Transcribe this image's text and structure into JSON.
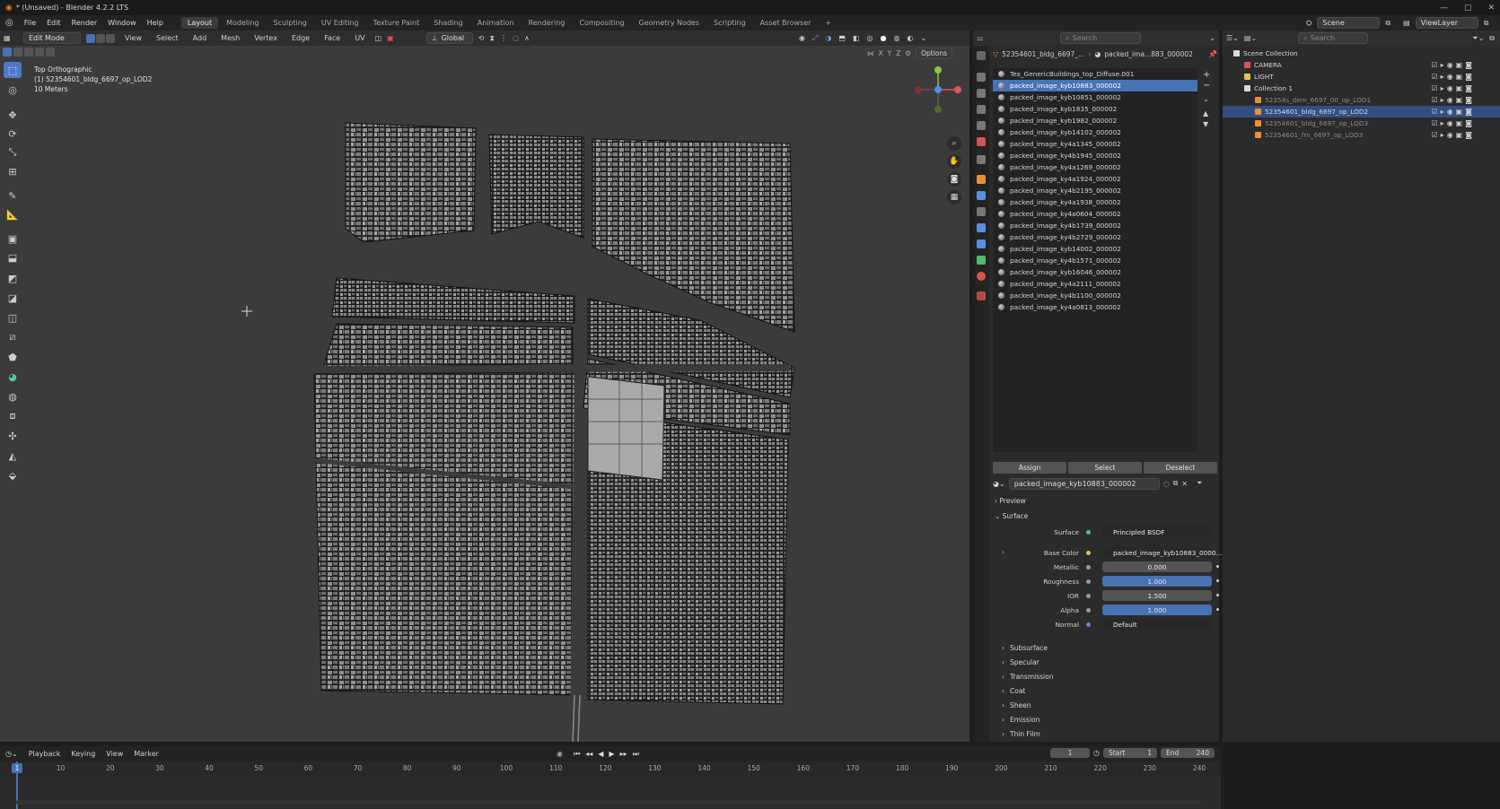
{
  "window": {
    "title": "* (Unsaved) - Blender 4.2.2 LTS",
    "controls": [
      "—",
      "▢",
      "✕"
    ]
  },
  "menu": [
    "File",
    "Edit",
    "Render",
    "Window",
    "Help"
  ],
  "workspaces": {
    "tabs": [
      "Layout",
      "Modeling",
      "Sculpting",
      "UV Editing",
      "Texture Paint",
      "Shading",
      "Animation",
      "Rendering",
      "Compositing",
      "Geometry Nodes",
      "Scripting",
      "Asset Browser"
    ],
    "active": "Layout",
    "add": "+"
  },
  "topright": {
    "scene": "Scene",
    "view_layer": "ViewLayer"
  },
  "viewport": {
    "mode": "Edit Mode",
    "menus": [
      "View",
      "Select",
      "Add",
      "Mesh",
      "Vertex",
      "Edge",
      "Face",
      "UV"
    ],
    "orientation": "Global",
    "options": "Options",
    "axes": [
      "X",
      "Y",
      "Z"
    ],
    "overlay_view": "Top Orthographic",
    "overlay_object": "(1) 52354601_bldg_6697_op_LOD2",
    "overlay_scale": "10 Meters"
  },
  "properties": {
    "breadcrumb_object": "52354601_bldg_6697_...",
    "breadcrumb_material": "packed_ima...883_000002",
    "search_placeholder": "Search",
    "materials": [
      "Tex_GenericBuildings_top_Diffuse.001",
      "packed_image_kyb10883_000002",
      "packed_image_kyb10851_000002",
      "packed_image_kyb1835_000002",
      "packed_image_kyb1982_000002",
      "packed_image_kyb14102_000002",
      "packed_image_ky4a1345_000002",
      "packed_image_ky4b1945_000002",
      "packed_image_ky4a1269_000002",
      "packed_image_ky4a1924_000002",
      "packed_image_ky4b2195_000002",
      "packed_image_ky4a1938_000002",
      "packed_image_ky4a0604_000002",
      "packed_image_ky4b1739_000002",
      "packed_image_ky4b2729_000002",
      "packed_image_kyb14002_000002",
      "packed_image_ky4b1571_000002",
      "packed_image_kyb16046_000002",
      "packed_image_ky4a2111_000002",
      "packed_image_ky4b1100_000002",
      "packed_image_ky4a0813_000002"
    ],
    "selected_material_index": 1,
    "buttons": [
      "Assign",
      "Select",
      "Deselect"
    ],
    "material_name": "packed_image_kyb10883_000002",
    "sections": {
      "preview": "Preview",
      "surface": "Surface"
    },
    "surface": [
      {
        "label": "Surface",
        "value": "Principled BSDF"
      },
      {
        "label": "Base Color",
        "value": "packed_image_kyb10883_0000..."
      },
      {
        "label": "Metallic",
        "value": "0.000"
      },
      {
        "label": "Roughness",
        "value": "1.000"
      },
      {
        "label": "IOR",
        "value": "1.500"
      },
      {
        "label": "Alpha",
        "value": "1.000"
      },
      {
        "label": "Normal",
        "value": "Default"
      }
    ],
    "subsections": [
      "Subsurface",
      "Specular",
      "Transmission",
      "Coat",
      "Sheen",
      "Emission",
      "Thin Film"
    ]
  },
  "outliner": {
    "search_placeholder": "Search",
    "root": "Scene Collection",
    "items": [
      {
        "name": "CAMERA",
        "depth": 1
      },
      {
        "name": "LIGHT",
        "depth": 1
      },
      {
        "name": "Collection 1",
        "depth": 1
      },
      {
        "name": "52354s_dem_6697_00_op_LOD1",
        "depth": 2
      },
      {
        "name": "52354601_bldg_6697_op_LOD2",
        "depth": 2
      },
      {
        "name": "52354601_bldg_6697_op_LOD3",
        "depth": 2
      },
      {
        "name": "52354601_frn_6697_op_LOD3",
        "depth": 2
      }
    ],
    "selected": "52354601_bldg_6697_op_LOD2"
  },
  "timeline": {
    "menus": [
      "Playback",
      "Keying",
      "View",
      "Marker"
    ],
    "current_frame": "1",
    "start_label": "Start",
    "start": "1",
    "end_label": "End",
    "end": "240",
    "ticks": [
      "10",
      "20",
      "30",
      "40",
      "50",
      "60",
      "70",
      "80",
      "90",
      "100",
      "110",
      "120",
      "130",
      "140",
      "150",
      "160",
      "170",
      "180",
      "190",
      "200",
      "210",
      "220",
      "230",
      "240"
    ],
    "transport": [
      "⏮",
      "◂◂",
      "◀",
      "▶",
      "▸▸",
      "⏭"
    ]
  }
}
